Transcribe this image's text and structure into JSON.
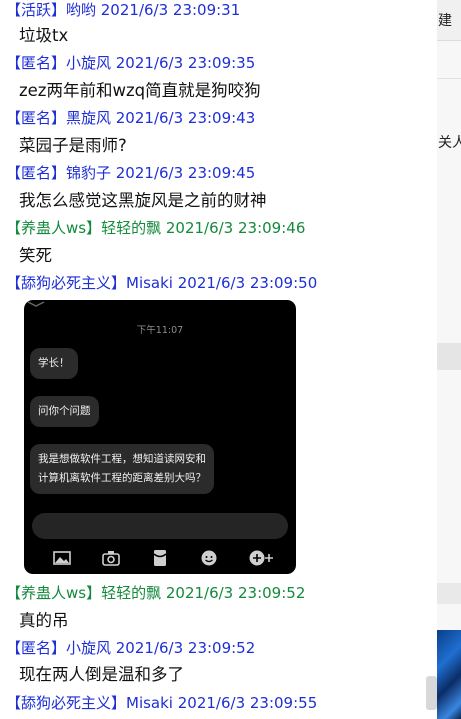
{
  "messages": [
    {
      "header": "【活跃】哟哟 2021/6/3 23:09:31",
      "text": "垃圾tx"
    },
    {
      "header": "【匿名】小旋风 2021/6/3 23:09:35",
      "text": "zez两年前和wzq简直就是狗咬狗"
    },
    {
      "header": "【匿名】黑旋风 2021/6/3 23:09:43",
      "text": "菜园子是雨师?"
    },
    {
      "header": "【匿名】锦豹子 2021/6/3 23:09:45",
      "text": "我怎么感觉这黑旋风是之前的财神"
    },
    {
      "header": "【养蛊人ws】轻轻的飘 2021/6/3 23:09:46",
      "text": "笑死"
    },
    {
      "header": "【舔狗必死主义】Misaki 2021/6/3 23:09:50",
      "text": ""
    },
    {
      "header": "【养蛊人ws】轻轻的飘 2021/6/3 23:09:52",
      "text": "真的吊"
    },
    {
      "header": "【匿名】小旋风 2021/6/3 23:09:52",
      "text": "现在两人倒是温和多了"
    },
    {
      "header": "【舔狗必死主义】Misaki 2021/6/3 23:09:55",
      "text": ""
    }
  ],
  "image": {
    "time": "下午11:07",
    "bubbles": [
      "学长！",
      "问你个问题",
      "我是想做软件工程，想知道读网安和",
      "计算机离软件工程的距离差别大吗？"
    ]
  },
  "side": {
    "top_text": "建",
    "mid_text": "关人"
  },
  "colors": {
    "blue": "#1f2fd6",
    "green": "#138a3c"
  }
}
